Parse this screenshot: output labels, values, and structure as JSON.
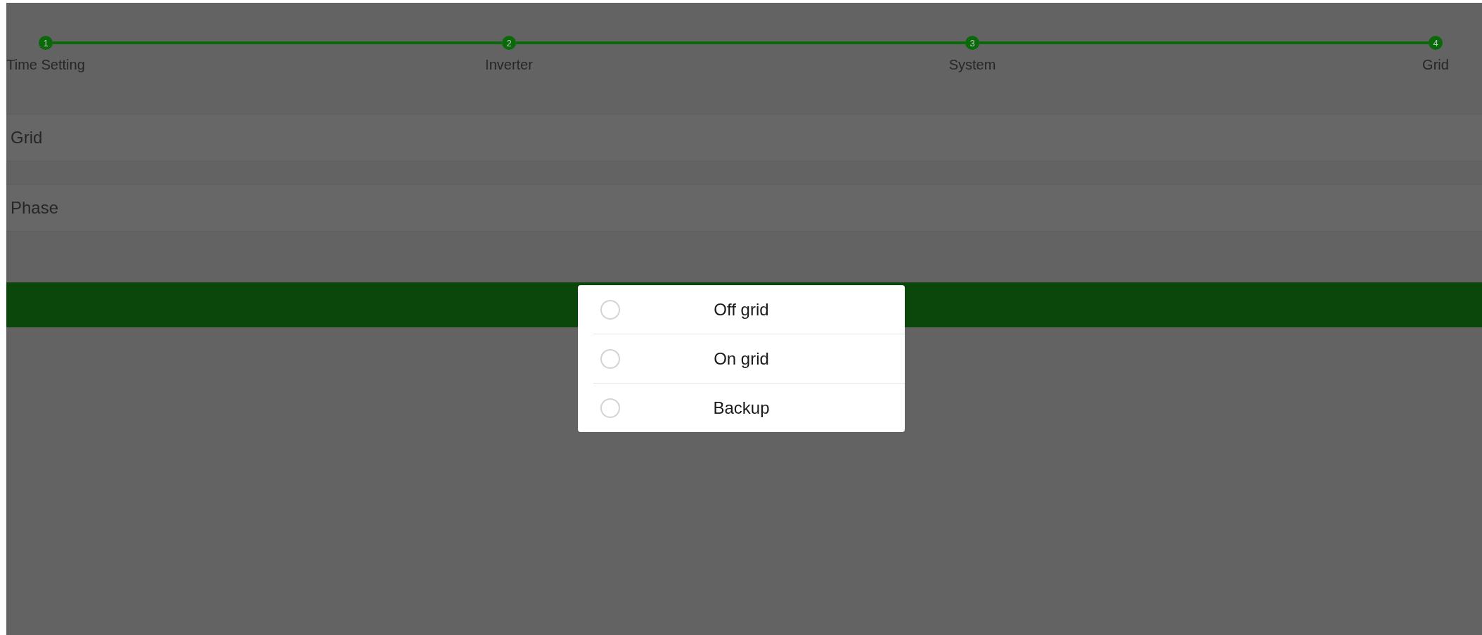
{
  "steps": [
    {
      "number": "1",
      "label": "Time Setting",
      "completed": true
    },
    {
      "number": "2",
      "label": "Inverter",
      "completed": true
    },
    {
      "number": "3",
      "label": "System",
      "completed": true
    },
    {
      "number": "4",
      "label": "Grid",
      "completed": true
    }
  ],
  "fields": [
    {
      "label": "Grid"
    },
    {
      "label": "Phase"
    }
  ],
  "dialog": {
    "options": [
      {
        "label": "Off grid",
        "selected": false
      },
      {
        "label": "On grid",
        "selected": false
      },
      {
        "label": "Backup",
        "selected": false
      }
    ]
  }
}
